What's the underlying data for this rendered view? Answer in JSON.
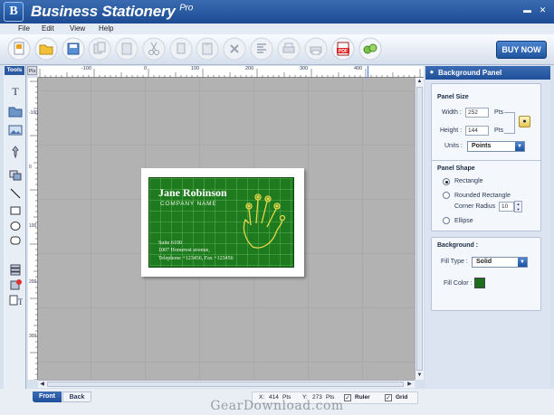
{
  "app": {
    "title": "Business Stationery",
    "edition": "Pro",
    "logo_letter": "B"
  },
  "window": {
    "minimize": "▬",
    "close": "✕"
  },
  "menu": [
    "File",
    "Edit",
    "View",
    "Help"
  ],
  "toolbar": {
    "icons": [
      "new-document-icon",
      "open-folder-icon",
      "save-icon",
      "copy-design-icon",
      "paste-design-icon",
      "cut-icon",
      "copy-icon",
      "paste-icon",
      "delete-icon",
      "align-icon",
      "print-preview-icon",
      "print-icon",
      "print-setup-icon",
      "pdf-export-icon",
      "share-icon"
    ],
    "buy_label": "BUY NOW"
  },
  "tools": {
    "label": "Tools",
    "units_label": "Pts",
    "items": [
      "text-tool-icon",
      "open-image-icon",
      "image-tool-icon",
      "pin-icon",
      "layers-icon",
      "line-tool-icon",
      "rectangle-tool-icon",
      "ellipse-tool-icon",
      "rounded-rect-tool-icon",
      "stack-icon",
      "effects-icon",
      "text-format-icon"
    ]
  },
  "ruler": {
    "h_labels": [
      "-100",
      "0",
      "100",
      "200",
      "300",
      "400"
    ],
    "v_labels": [
      "-100",
      "0",
      "100",
      "200",
      "300"
    ]
  },
  "card": {
    "name": "Jane Robinson",
    "company": "Company Name",
    "address1": "Suite 6100",
    "address2": "1007 Homerest avenue,",
    "phone": "Telephone +123456, Fax +123456",
    "bg_color": "#1e7a1e"
  },
  "side_panel": {
    "title": "Background Panel",
    "panel_size": {
      "heading": "Panel Size",
      "width_label": "Width :",
      "width_value": "252",
      "width_unit": "Pts",
      "height_label": "Height :",
      "height_value": "144",
      "height_unit": "Pts",
      "units_label": "Units :",
      "units_value": "Points"
    },
    "panel_shape": {
      "heading": "Panel Shape",
      "options": [
        "Rectangle",
        "Rounded Rectangle",
        "Ellipse"
      ],
      "selected": "Rectangle",
      "corner_label": "Corner Radius",
      "corner_value": "10"
    },
    "background": {
      "heading": "Background :",
      "fill_type_label": "Fill Type :",
      "fill_type_value": "Solid",
      "fill_color_label": "Fill Color :",
      "fill_color": "#1c6e1c"
    }
  },
  "status": {
    "tabs": [
      "Front",
      "Back"
    ],
    "active_tab": "Front",
    "x_label": "X:",
    "x_value": "414",
    "x_unit": "Pts",
    "y_label": "Y:",
    "y_value": "273",
    "y_unit": "Pts",
    "ruler_label": "Ruler",
    "ruler_on": true,
    "grid_label": "Grid",
    "grid_on": true
  },
  "watermark": "GearDownload.com"
}
